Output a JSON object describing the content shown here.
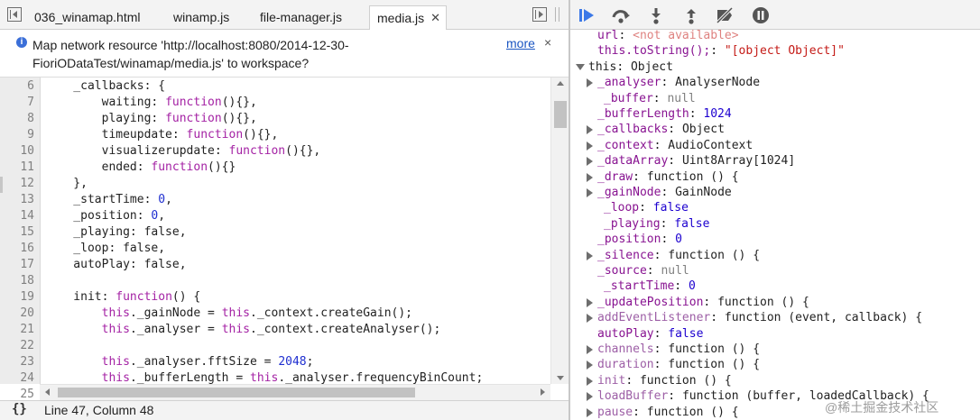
{
  "tabs": [
    {
      "label": "036_winamap.html"
    },
    {
      "label": "winamp.js"
    },
    {
      "label": "file-manager.js"
    },
    {
      "label": "media.js",
      "active": true
    }
  ],
  "infobar": {
    "line1": "Map network resource 'http://localhost:8080/2014-12-30-",
    "line2": "FioriODataTest/winamap/media.js' to workspace?",
    "more": "more",
    "close": "×"
  },
  "code": [
    {
      "n": "6",
      "text": "    _callbacks: {"
    },
    {
      "n": "7",
      "text": "        waiting: function(){},"
    },
    {
      "n": "8",
      "text": "        playing: function(){},"
    },
    {
      "n": "9",
      "text": "        timeupdate: function(){},"
    },
    {
      "n": "10",
      "text": "        visualizerupdate: function(){},"
    },
    {
      "n": "11",
      "text": "        ended: function(){}"
    },
    {
      "n": "12",
      "text": "    },"
    },
    {
      "n": "13",
      "text": "    _startTime: 0,"
    },
    {
      "n": "14",
      "text": "    _position: 0,"
    },
    {
      "n": "15",
      "text": "    _playing: false,"
    },
    {
      "n": "16",
      "text": "    _loop: false,"
    },
    {
      "n": "17",
      "text": "    autoPlay: false,"
    },
    {
      "n": "18",
      "text": ""
    },
    {
      "n": "19",
      "text": "    init: function() {"
    },
    {
      "n": "20",
      "text": "        this._gainNode = this._context.createGain();"
    },
    {
      "n": "21",
      "text": "        this._analyser = this._context.createAnalyser();"
    },
    {
      "n": "22",
      "text": ""
    },
    {
      "n": "23",
      "text": "        this._analyser.fftSize = 2048;"
    },
    {
      "n": "24",
      "text": "        this._bufferLength = this._analyser.frequencyBinCount;"
    },
    {
      "n": "25",
      "text": ""
    }
  ],
  "status": {
    "braces": "{}",
    "cursor": "Line 47, Column 48"
  },
  "debugger_buttons": [
    {
      "icon": "resume-icon",
      "color": "#3b78e7"
    },
    {
      "icon": "step-over-icon"
    },
    {
      "icon": "step-into-icon"
    },
    {
      "icon": "step-out-icon"
    },
    {
      "icon": "deactivate-breakpoints-icon"
    },
    {
      "icon": "pause-on-exceptions-icon"
    }
  ],
  "scope": [
    {
      "indent": 1,
      "key": "url",
      "value": "<not available>",
      "vtype": "na"
    },
    {
      "indent": 1,
      "key": "this.toString();",
      "value": "\"[object Object]\"",
      "vtype": "str"
    },
    {
      "indent": 0,
      "toggle": "open",
      "key": "this",
      "value": "Object",
      "vtype": "obj",
      "plainKey": true
    },
    {
      "indent": 1,
      "toggle": "closed",
      "key": "_analyser",
      "value": "AnalyserNode",
      "vtype": "obj"
    },
    {
      "indent": 2,
      "key": "_buffer",
      "value": "null",
      "vtype": "null"
    },
    {
      "indent": 1,
      "key": "_bufferLength",
      "value": "1024",
      "vtype": "num"
    },
    {
      "indent": 1,
      "toggle": "closed",
      "key": "_callbacks",
      "value": "Object",
      "vtype": "obj"
    },
    {
      "indent": 1,
      "toggle": "closed",
      "key": "_context",
      "value": "AudioContext",
      "vtype": "obj"
    },
    {
      "indent": 1,
      "toggle": "closed",
      "key": "_dataArray",
      "value": "Uint8Array[1024]",
      "vtype": "obj"
    },
    {
      "indent": 1,
      "toggle": "closed",
      "key": "_draw",
      "value": "function () {",
      "vtype": "obj"
    },
    {
      "indent": 1,
      "toggle": "closed",
      "key": "_gainNode",
      "value": "GainNode",
      "vtype": "obj"
    },
    {
      "indent": 2,
      "key": "_loop",
      "value": "false",
      "vtype": "num"
    },
    {
      "indent": 2,
      "key": "_playing",
      "value": "false",
      "vtype": "num"
    },
    {
      "indent": 1,
      "key": "_position",
      "value": "0",
      "vtype": "num"
    },
    {
      "indent": 1,
      "toggle": "closed",
      "key": "_silence",
      "value": "function () {",
      "vtype": "obj"
    },
    {
      "indent": 1,
      "key": "_source",
      "value": "null",
      "vtype": "null"
    },
    {
      "indent": 2,
      "key": "_startTime",
      "value": "0",
      "vtype": "num"
    },
    {
      "indent": 1,
      "toggle": "closed",
      "key": "_updatePosition",
      "value": "function () {",
      "vtype": "obj"
    },
    {
      "indent": 1,
      "toggle": "closed",
      "key": "addEventListener",
      "value": "function (event, callback) {",
      "vtype": "obj",
      "proto": true
    },
    {
      "indent": 1,
      "key": "autoPlay",
      "value": "false",
      "vtype": "num"
    },
    {
      "indent": 1,
      "toggle": "closed",
      "key": "channels",
      "value": "function () {",
      "vtype": "obj",
      "proto": true
    },
    {
      "indent": 1,
      "toggle": "closed",
      "key": "duration",
      "value": "function () {",
      "vtype": "obj",
      "proto": true
    },
    {
      "indent": 1,
      "toggle": "closed",
      "key": "init",
      "value": "function () {",
      "vtype": "obj",
      "proto": true
    },
    {
      "indent": 1,
      "toggle": "closed",
      "key": "loadBuffer",
      "value": "function (buffer, loadedCallback) {",
      "vtype": "obj",
      "proto": true
    },
    {
      "indent": 1,
      "toggle": "closed",
      "key": "pause",
      "value": "function () {",
      "vtype": "obj",
      "proto": true
    }
  ],
  "watermark": "@稀土掘金技术社区"
}
